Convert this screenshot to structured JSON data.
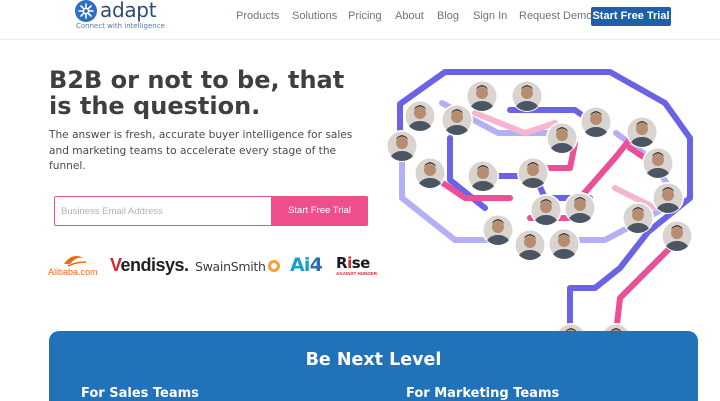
{
  "brand": {
    "name": "adapt",
    "tagline": "Connect with intelligence",
    "colors": {
      "primary": "#1d5fa8",
      "accent": "#ef4e8c",
      "panel": "#2172b9"
    }
  },
  "nav": {
    "items": [
      {
        "label": "Products"
      },
      {
        "label": "Solutions"
      },
      {
        "label": "Pricing"
      },
      {
        "label": "About"
      },
      {
        "label": "Blog"
      },
      {
        "label": "Sign In"
      },
      {
        "label": "Request Demo"
      }
    ],
    "cta": "Start Free Trial"
  },
  "hero": {
    "title": "B2B or not to be, that is the question.",
    "subtitle": "The answer is fresh, accurate buyer intelligence for sales and marketing teams to accelerate every stage of the funnel.",
    "form": {
      "placeholder": "Business Email Address",
      "submit": "Start Free Trial"
    }
  },
  "client_logos": {
    "alibaba": "Alibaba.com",
    "vendisys_v": "V",
    "vendisys_rest": "endisys.",
    "swainsmith": "SwainSmith",
    "ai4_a": "Ai",
    "ai4_4": "4",
    "rise_r": "R",
    "rise_i": "i",
    "rise_rest": "se",
    "rise_sub": "AGAINST HUNGER"
  },
  "illustration": {
    "avatar_icon": "person-avatar-icon",
    "path_colors": [
      "#6b63e6",
      "#ec4f96",
      "#b3b0f5",
      "#f6b6d2"
    ]
  },
  "panel": {
    "title": "Be Next Level",
    "columns": [
      {
        "label": "For Sales Teams"
      },
      {
        "label": "For Marketing Teams"
      }
    ]
  }
}
